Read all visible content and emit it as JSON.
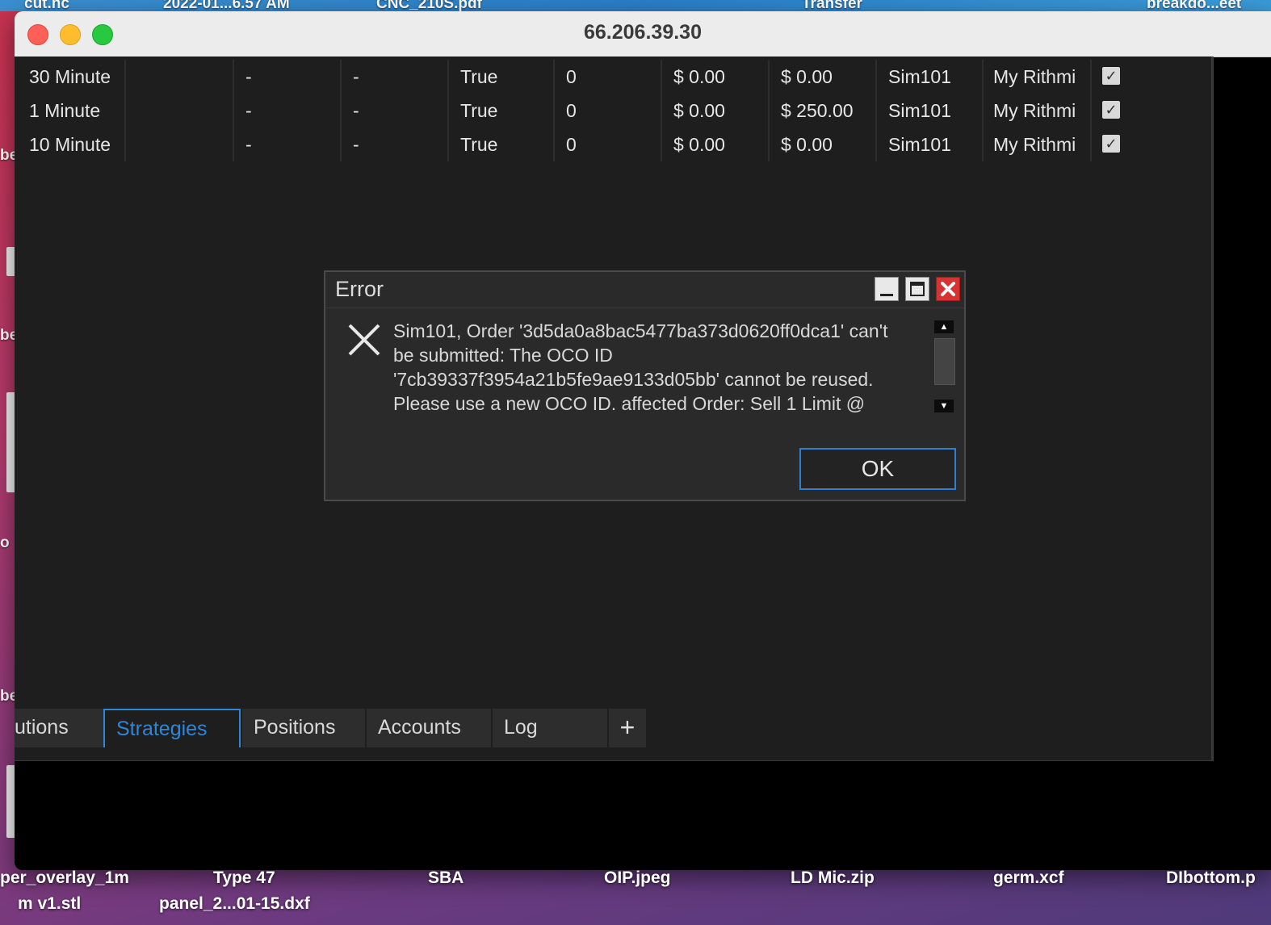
{
  "desktop": {
    "top_items": [
      "cut.nc",
      "2022-01...6.57 AM",
      "CNC_210S.pdf",
      "Transfer",
      "breakdo...eet"
    ],
    "left_fragments": [
      "be",
      "be",
      "o",
      "be"
    ],
    "icons": [
      {
        "line1": "per_overlay_1m",
        "line2": "m v1.stl"
      },
      {
        "line1": "Type 47",
        "line2": "panel_2...01-15.dxf"
      },
      {
        "line1": "SBA",
        "line2": ""
      },
      {
        "line1": "OIP.jpeg",
        "line2": ""
      },
      {
        "line1": "LD Mic.zip",
        "line2": ""
      },
      {
        "line1": "germ.xcf",
        "line2": ""
      },
      {
        "line1": "DIbottom.p",
        "line2": ""
      }
    ]
  },
  "window": {
    "title": "66.206.39.30"
  },
  "strategies": {
    "rows": [
      {
        "name": "30 Minute",
        "c2": "",
        "c3": "-",
        "c4": "-",
        "enabled": "True",
        "qty": "0",
        "realized": "$ 0.00",
        "unrealized": "$ 0.00",
        "account": "Sim101",
        "connection": "My Rithmi",
        "checked": true
      },
      {
        "name": "1 Minute",
        "c2": "",
        "c3": "-",
        "c4": "-",
        "enabled": "True",
        "qty": "0",
        "realized": "$ 0.00",
        "unrealized": "$ 250.00",
        "account": "Sim101",
        "connection": "My Rithmi",
        "checked": true
      },
      {
        "name": "10 Minute",
        "c2": "",
        "c3": "-",
        "c4": "-",
        "enabled": "True",
        "qty": "0",
        "realized": "$ 0.00",
        "unrealized": "$ 0.00",
        "account": "Sim101",
        "connection": "My Rithmi",
        "checked": true
      }
    ]
  },
  "tabs": [
    {
      "label": "utions",
      "active": false
    },
    {
      "label": "Strategies",
      "active": true
    },
    {
      "label": "Positions",
      "active": false
    },
    {
      "label": "Accounts",
      "active": false
    },
    {
      "label": "Log",
      "active": false
    },
    {
      "label": "+",
      "active": false
    }
  ],
  "dialog": {
    "title": "Error",
    "message_lines": [
      "Sim101, Order '3d5da0a8bac5477ba373d0620ff0dca1' can't",
      "be submitted: The OCO ID",
      "'7cb39337f3954a21b5fe9ae9133d05bb' cannot be reused.",
      "Please use a new OCO ID. affected Order: Sell 1 Limit @"
    ],
    "ok_label": "OK",
    "icons": {
      "error": "x-icon",
      "minimize": "minimize-icon",
      "maximize": "maximize-icon",
      "close": "close-icon"
    }
  },
  "colors": {
    "accent": "#2f86d8",
    "dialog_close": "#d83232",
    "panel_bg": "#1e1e1e"
  }
}
